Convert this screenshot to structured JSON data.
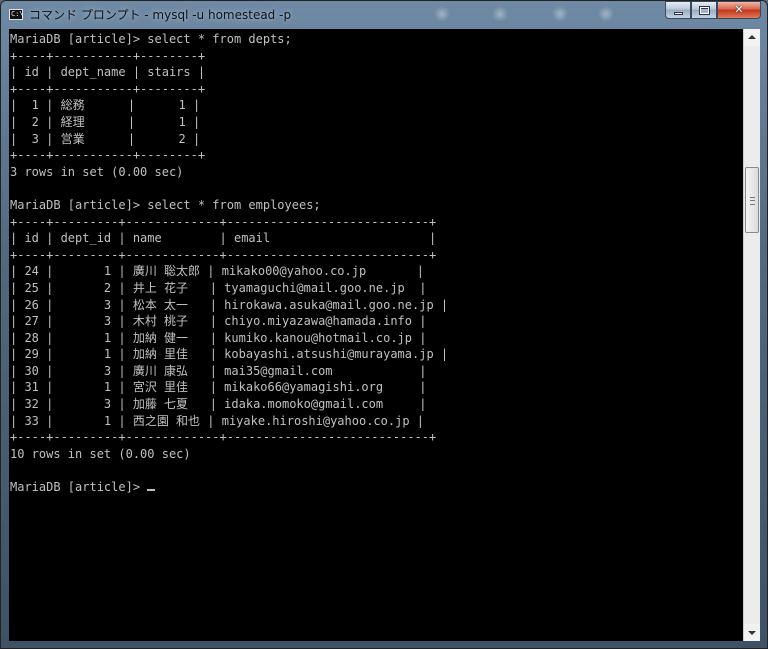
{
  "window": {
    "title": "コマンド プロンプト - mysql  -u homestead -p",
    "app_icon_text": "C:\\"
  },
  "console_lines": [
    "MariaDB [article]> select * from depts;",
    "+----+-----------+--------+",
    "| id | dept_name | stairs |",
    "+----+-----------+--------+",
    "|  1 | 総務      |      1 |",
    "|  2 | 経理      |      1 |",
    "|  3 | 営業      |      2 |",
    "+----+-----------+--------+",
    "3 rows in set (0.00 sec)",
    "",
    "MariaDB [article]> select * from employees;",
    "+----+---------+-------------+----------------------------+",
    "| id | dept_id | name        | email                      |",
    "+----+---------+-------------+----------------------------+",
    "| 24 |       1 | 廣川 聡太郎 | mikako00@yahoo.co.jp       |",
    "| 25 |       2 | 井上 花子   | tyamaguchi@mail.goo.ne.jp  |",
    "| 26 |       3 | 松本 太一   | hirokawa.asuka@mail.goo.ne.jp |",
    "| 27 |       3 | 木村 桃子   | chiyo.miyazawa@hamada.info |",
    "| 28 |       1 | 加納 健一   | kumiko.kanou@hotmail.co.jp |",
    "| 29 |       1 | 加納 里佳   | kobayashi.atsushi@murayama.jp |",
    "| 30 |       3 | 廣川 康弘   | mai35@gmail.com            |",
    "| 31 |       1 | 宮沢 里佳   | mikako66@yamagishi.org     |",
    "| 32 |       3 | 加藤 七夏   | idaka.momoko@gmail.com     |",
    "| 33 |       1 | 西之園 和也 | miyake.hiroshi@yahoo.co.jp |",
    "+----+---------+-------------+----------------------------+",
    "10 rows in set (0.00 sec)",
    "",
    "MariaDB [article]> "
  ],
  "icons": {
    "minimize": "minimize-icon",
    "maximize": "maximize-icon",
    "close": "close-icon"
  }
}
